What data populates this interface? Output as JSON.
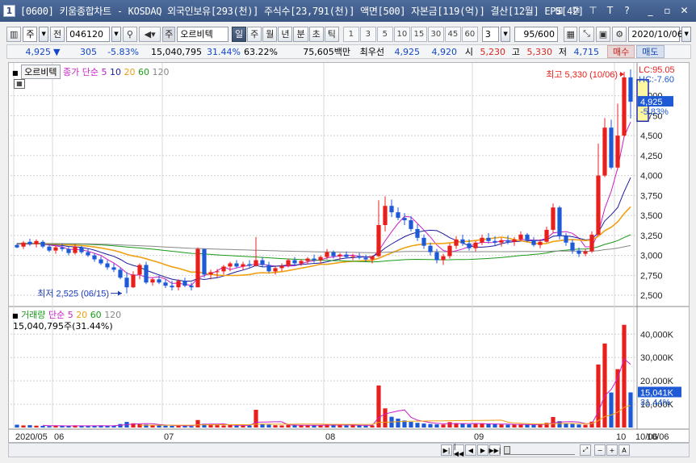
{
  "window": {
    "number": "1",
    "title": "[0600] 키움종합차트 - KOSDAQ 외국인보유[293(천)] 주식수[23,791(천)] 액면[500] 자본금[119(억)] 결산[12월] EPS[42]",
    "controls": [
      "⊞",
      "⧉",
      "⊤",
      "T",
      "?",
      "_",
      "▫",
      "✕"
    ]
  },
  "toolbar": {
    "chart_icon": "▥",
    "period_select": "주",
    "prev_btn": "전",
    "stock_code": "046120",
    "stock_name": "오르비텍",
    "prefix_label": "주",
    "period_tabs": [
      "일",
      "주",
      "월",
      "년",
      "분",
      "초",
      "틱"
    ],
    "active_period": "일",
    "num_buttons": [
      "1",
      "3",
      "5",
      "10",
      "15",
      "30",
      "45",
      "60"
    ],
    "interval_value": "3",
    "count_value": "95/600",
    "date_value": "2020/10/06"
  },
  "quote": {
    "price": "4,925",
    "direction": "▼",
    "change": "305",
    "change_pct": "-5.83%",
    "volume": "15,040,795",
    "volume_pct": "31.44%",
    "ratio": "63.22%",
    "trade_amount": "75,605백만",
    "best_label": "최우선",
    "ask": "4,925",
    "bid": "4,920",
    "open_label": "시",
    "open": "5,230",
    "high_label": "고",
    "high": "5,330",
    "low_label": "저",
    "low": "4,715",
    "buy_btn": "매수",
    "sell_btn": "매도"
  },
  "price_panel": {
    "tag": "오르비텍",
    "ma_label": "종가 단순",
    "ma_periods": [
      "5",
      "10",
      "20",
      "60",
      "120"
    ],
    "lc_label": "LC:95.05",
    "hc_label": "HC:-7.60",
    "high_annot": "최고 5,330 (10/06)",
    "low_annot": "최저 2,525 (06/15)",
    "last_price": "4,925",
    "last_change": "-5.83%",
    "y_ticks": [
      "5,000",
      "4,750",
      "4,500",
      "4,250",
      "4,000",
      "3,750",
      "3,500",
      "3,250",
      "3,000",
      "2,750",
      "2,500"
    ]
  },
  "volume_panel": {
    "tag": "거래량",
    "ma_label": "단순",
    "ma_periods": [
      "5",
      "20",
      "60",
      "120"
    ],
    "info": "15,040,795주(31.44%)",
    "last_volume": "15,041K",
    "last_pct": "31.44%",
    "y_ticks": [
      "40,000K",
      "30,000K",
      "20,000K",
      "10,000K"
    ]
  },
  "x_axis": {
    "labels": [
      "2020/05",
      "06",
      "07",
      "08",
      "09",
      "10",
      "10/06"
    ]
  },
  "colors": {
    "up": "#e8201c",
    "down": "#1e5ad6",
    "ma5": "#c81ec8",
    "ma10": "#1c1c9c",
    "ma20": "#f0a010",
    "ma60": "#1a9a1a",
    "ma120": "#888888"
  },
  "chart_data": {
    "type": "candlestick",
    "dates": [
      "2020/05",
      "",
      "",
      "",
      "",
      "",
      "06",
      "",
      "",
      "",
      "",
      "",
      "",
      "",
      "",
      "",
      "",
      "",
      "",
      "",
      "",
      "",
      "",
      "07",
      "",
      "",
      "",
      "",
      "",
      "",
      "",
      "",
      "",
      "",
      "",
      "",
      "",
      "",
      "",
      "",
      "",
      "",
      "",
      "",
      "",
      "",
      "",
      "",
      "08",
      "",
      "",
      "",
      "",
      "",
      "",
      "",
      "",
      "",
      "",
      "",
      "",
      "",
      "",
      "",
      "",
      "",
      "",
      "",
      "",
      "",
      "",
      "09",
      "",
      "",
      "",
      "",
      "",
      "",
      "",
      "",
      "",
      "",
      "",
      "",
      "",
      "",
      "",
      "",
      "",
      "",
      "",
      "",
      "",
      "10",
      "",
      "",
      "10/06"
    ],
    "ohlc": [
      [
        3130,
        3150,
        3090,
        3100
      ],
      [
        3110,
        3180,
        3080,
        3160
      ],
      [
        3170,
        3210,
        3120,
        3140
      ],
      [
        3140,
        3200,
        3100,
        3180
      ],
      [
        3170,
        3190,
        3090,
        3110
      ],
      [
        3110,
        3140,
        3040,
        3060
      ],
      [
        3060,
        3120,
        3020,
        3100
      ],
      [
        3100,
        3150,
        3050,
        3080
      ],
      [
        3080,
        3110,
        3000,
        3030
      ],
      [
        3030,
        3140,
        3010,
        3110
      ],
      [
        3100,
        3120,
        3020,
        3040
      ],
      [
        3040,
        3080,
        2980,
        3000
      ],
      [
        3000,
        3030,
        2920,
        2950
      ],
      [
        2950,
        2990,
        2880,
        2900
      ],
      [
        2900,
        2940,
        2820,
        2850
      ],
      [
        2850,
        2900,
        2790,
        2820
      ],
      [
        2820,
        2850,
        2700,
        2720
      ],
      [
        2720,
        2790,
        2525,
        2600
      ],
      [
        2600,
        2800,
        2590,
        2760
      ],
      [
        2760,
        2900,
        2700,
        2880
      ],
      [
        2880,
        2920,
        2640,
        2660
      ],
      [
        2660,
        2720,
        2620,
        2700
      ],
      [
        2700,
        2760,
        2640,
        2660
      ],
      [
        2660,
        2700,
        2590,
        2620
      ],
      [
        2620,
        2680,
        2560,
        2600
      ],
      [
        2600,
        2700,
        2560,
        2680
      ],
      [
        2680,
        2720,
        2600,
        2620
      ],
      [
        2620,
        2660,
        2560,
        2600
      ],
      [
        2600,
        3100,
        2600,
        3080
      ],
      [
        3080,
        3060,
        2720,
        2760
      ],
      [
        2760,
        2820,
        2700,
        2790
      ],
      [
        2790,
        2830,
        2720,
        2800
      ],
      [
        2800,
        2880,
        2760,
        2860
      ],
      [
        2860,
        2920,
        2800,
        2900
      ],
      [
        2900,
        2940,
        2840,
        2860
      ],
      [
        2860,
        2920,
        2820,
        2890
      ],
      [
        2890,
        2940,
        2850,
        2870
      ],
      [
        2870,
        3230,
        2860,
        2940
      ],
      [
        2940,
        2980,
        2860,
        2880
      ],
      [
        2880,
        2920,
        2780,
        2800
      ],
      [
        2800,
        2860,
        2760,
        2840
      ],
      [
        2840,
        2900,
        2800,
        2870
      ],
      [
        2870,
        2960,
        2850,
        2940
      ],
      [
        2940,
        2980,
        2880,
        2900
      ],
      [
        2900,
        2950,
        2870,
        2930
      ],
      [
        2930,
        2980,
        2890,
        2960
      ],
      [
        2960,
        3010,
        2910,
        2940
      ],
      [
        2940,
        3000,
        2900,
        2980
      ],
      [
        2980,
        3080,
        2950,
        3040
      ],
      [
        3040,
        3060,
        2960,
        2990
      ],
      [
        2990,
        3030,
        2940,
        3010
      ],
      [
        3010,
        3050,
        2960,
        2980
      ],
      [
        2980,
        3020,
        2940,
        2990
      ],
      [
        2990,
        3030,
        2950,
        2970
      ],
      [
        2970,
        3010,
        2920,
        2950
      ],
      [
        2950,
        3000,
        2900,
        2990
      ],
      [
        2990,
        3690,
        2980,
        3380
      ],
      [
        3380,
        3740,
        3300,
        3620
      ],
      [
        3620,
        3700,
        3480,
        3540
      ],
      [
        3540,
        3600,
        3440,
        3470
      ],
      [
        3470,
        3530,
        3380,
        3440
      ],
      [
        3440,
        3490,
        3300,
        3330
      ],
      [
        3330,
        3390,
        3180,
        3220
      ],
      [
        3220,
        3260,
        3080,
        3120
      ],
      [
        3120,
        3160,
        3000,
        3040
      ],
      [
        3040,
        3080,
        2900,
        2940
      ],
      [
        2940,
        3020,
        2880,
        2990
      ],
      [
        2990,
        3150,
        2960,
        3120
      ],
      [
        3120,
        3240,
        3080,
        3200
      ],
      [
        3200,
        3260,
        3120,
        3150
      ],
      [
        3150,
        3200,
        3060,
        3090
      ],
      [
        3090,
        3180,
        3050,
        3160
      ],
      [
        3160,
        3260,
        3130,
        3220
      ],
      [
        3220,
        3280,
        3150,
        3180
      ],
      [
        3180,
        3240,
        3120,
        3160
      ],
      [
        3160,
        3220,
        3110,
        3190
      ],
      [
        3190,
        3250,
        3140,
        3170
      ],
      [
        3170,
        3230,
        3120,
        3200
      ],
      [
        3200,
        3300,
        3180,
        3260
      ],
      [
        3260,
        3280,
        3170,
        3190
      ],
      [
        3190,
        3230,
        3110,
        3130
      ],
      [
        3130,
        3200,
        3090,
        3170
      ],
      [
        3170,
        3360,
        3160,
        3320
      ],
      [
        3320,
        3650,
        3280,
        3600
      ],
      [
        3600,
        3620,
        3200,
        3240
      ],
      [
        3240,
        3280,
        3120,
        3160
      ],
      [
        3160,
        3200,
        3020,
        3060
      ],
      [
        3060,
        3100,
        2980,
        3020
      ],
      [
        3020,
        3080,
        2990,
        3050
      ],
      [
        3050,
        3300,
        3030,
        3260
      ],
      [
        3260,
        4400,
        3250,
        4000
      ],
      [
        4000,
        4720,
        3980,
        4600
      ],
      [
        4600,
        4700,
        4080,
        4100
      ],
      [
        4100,
        4900,
        4080,
        4500
      ],
      [
        4500,
        5300,
        4480,
        5230
      ],
      [
        5230,
        5330,
        4715,
        4925
      ]
    ],
    "volume_k": [
      1200,
      900,
      1000,
      800,
      700,
      600,
      700,
      800,
      600,
      900,
      700,
      600,
      800,
      900,
      700,
      800,
      1500,
      2400,
      1800,
      1400,
      1300,
      1000,
      900,
      800,
      700,
      800,
      700,
      600,
      3200,
      1600,
      1100,
      1000,
      900,
      1100,
      800,
      800,
      900,
      7600,
      1500,
      1200,
      1000,
      900,
      1100,
      1000,
      900,
      1000,
      900,
      1000,
      1300,
      1000,
      1100,
      900,
      1000,
      900,
      800,
      900,
      18000,
      8200,
      4600,
      3800,
      3000,
      2400,
      2000,
      1700,
      1500,
      1400,
      1300,
      2300,
      1900,
      1600,
      1400,
      1500,
      1800,
      1500,
      1400,
      1300,
      1200,
      1300,
      1400,
      1200,
      1100,
      1300,
      2000,
      4500,
      2700,
      1800,
      1500,
      1300,
      1200,
      2500,
      27000,
      36000,
      15000,
      25000,
      44000,
      15041
    ],
    "ylim": [
      2420,
      5330
    ],
    "vol_ylim": [
      0,
      47000
    ]
  }
}
